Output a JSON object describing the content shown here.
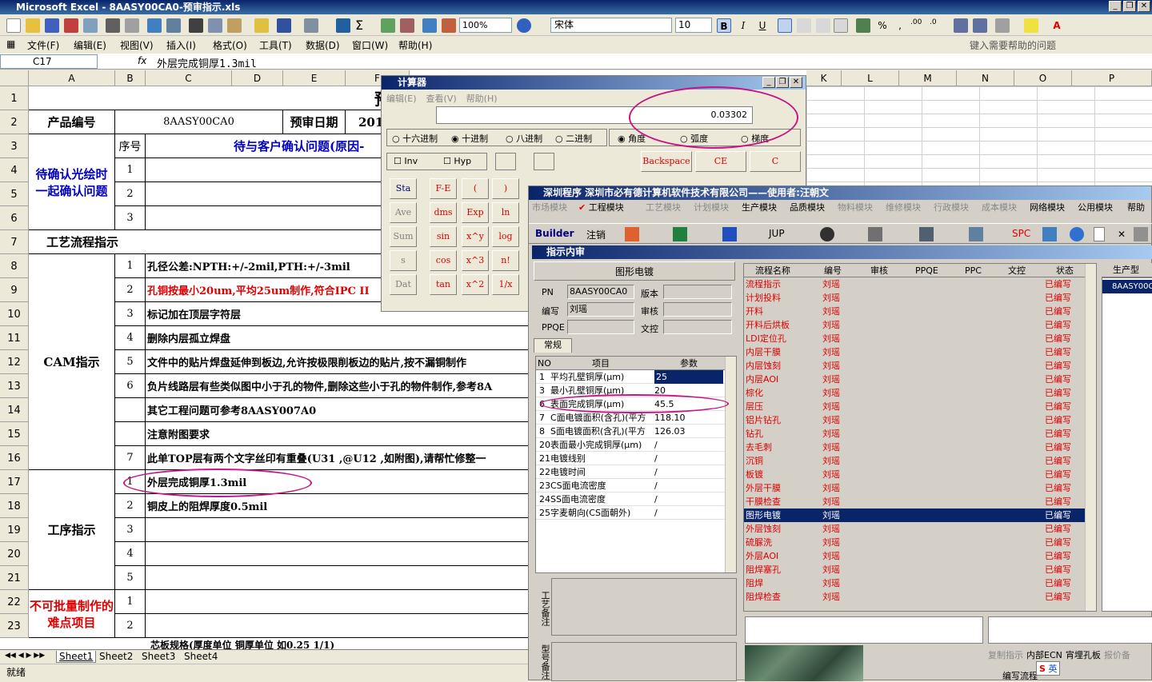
{
  "excel": {
    "title": "Microsoft Excel - 8AASY00CA0-预审指示.xls",
    "zoom": "100%",
    "font_name": "宋体",
    "font_size": "10",
    "menu": [
      "文件(F)",
      "编辑(E)",
      "视图(V)",
      "插入(I)",
      "格式(O)",
      "工具(T)",
      "数据(D)",
      "窗口(W)",
      "帮助(H)"
    ],
    "help_placeholder": "键入需要帮助的问题",
    "name_box": "C17",
    "fx": "fx",
    "formula": "外层完成铜厚1.3mil",
    "columns": [
      "A",
      "B",
      "C",
      "D",
      "E",
      "F",
      "K",
      "L",
      "M",
      "N",
      "O",
      "P"
    ],
    "rows": [
      "1",
      "2",
      "3",
      "4",
      "5",
      "6",
      "7",
      "8",
      "9",
      "10",
      "11",
      "12",
      "13",
      "14",
      "15",
      "16",
      "17",
      "18",
      "19",
      "20",
      "21",
      "22",
      "23"
    ],
    "title_cell": "预",
    "pn_label": "产品编号",
    "pn_value": "8AASY00CA0",
    "date_label": "预审日期",
    "date_value": "201",
    "confirm_label": "待确认光绘时一起确认问题",
    "seq_label": "序号",
    "confirm_title": "待与客户确认问题(原因-",
    "flow_label": "工艺流程指示",
    "cam_label": "CAM指示",
    "process_label": "工序指示",
    "difficult_label": "不可批量制作的难点项目",
    "cam_items": [
      {
        "no": "1",
        "text": "孔径公差:NPTH:+/-2mil,PTH:+/-3mil",
        "color": "#000000"
      },
      {
        "no": "2",
        "text": "孔铜按最小20um,平均25um制作,符合IPC II",
        "color": "#e00000"
      },
      {
        "no": "3",
        "text": "标记加在顶层字符层",
        "color": "#000000"
      },
      {
        "no": "4",
        "text": "删除内层孤立焊盘",
        "color": "#000000"
      },
      {
        "no": "5",
        "text": "文件中的贴片焊盘延伸到板边,允许按极限削板边的贴片,按不漏铜制作",
        "color": "#000000"
      },
      {
        "no": "6",
        "text": "负片线路层有些类似图中小于孔的物件,删除这些小于孔的物件制作,参考8A",
        "color": "#000000"
      },
      {
        "no": "",
        "text": "其它工程问题可参考8AASY007A0",
        "color": "#000000"
      },
      {
        "no": "",
        "text": "注意附图要求",
        "color": "#000000"
      },
      {
        "no": "7",
        "text": "此单TOP层有两个文字丝印有重叠(U31 ,@U12 ,如附图),请帮忙修整一",
        "color": "#000000"
      }
    ],
    "process_items": [
      {
        "no": "1",
        "text": "外层完成铜厚1.3mil"
      },
      {
        "no": "2",
        "text": "铜皮上的阻焊厚度0.5mil"
      },
      {
        "no": "3",
        "text": ""
      },
      {
        "no": "4",
        "text": ""
      },
      {
        "no": "5",
        "text": ""
      }
    ],
    "confirm_nos": [
      "1",
      "2",
      "3"
    ],
    "difficult_nos": [
      "1",
      "2"
    ],
    "row24_text": "芯板规格(厚度单位    铜厚单位    如0.25 1/1)",
    "sheets": [
      "Sheet1",
      "Sheet2",
      "Sheet3",
      "Sheet4"
    ],
    "status": "就绪"
  },
  "calculator": {
    "title": "计算器",
    "menu": [
      "编辑(E)",
      "查看(V)",
      "帮助(H)"
    ],
    "display": "0.03302",
    "bases": [
      "十六进制",
      "十进制",
      "八进制",
      "二进制"
    ],
    "angles": [
      "角度",
      "弧度",
      "梯度"
    ],
    "inv": "Inv",
    "hyp": "Hyp",
    "backspace": "Backspace",
    "ce": "CE",
    "c": "C",
    "left_btns": [
      "Sta",
      "Ave",
      "Sum",
      "s",
      "Dat"
    ],
    "fn_col1": [
      "F-E",
      "dms",
      "sin",
      "cos",
      "tan"
    ],
    "fn_col2": [
      "(",
      "Exp",
      "x^y",
      "x^3",
      "x^2"
    ],
    "fn_col3": [
      ")",
      "ln",
      "log",
      "n!",
      "1/x"
    ]
  },
  "erp": {
    "title": "深圳程序    深圳市必有德计算机软件技术有限公司——使用者:汪朝文",
    "modules": [
      "市场模块",
      "工程模块",
      "工艺模块",
      "计划模块",
      "生产模块",
      "品质模块",
      "物料模块",
      "维修模块",
      "行政模块",
      "成本模块",
      "网络模块",
      "公用模块",
      "帮助"
    ],
    "toolbar": [
      "Builder",
      "注销",
      "JUP",
      "SPC"
    ],
    "subwin_title": "指示内审",
    "section": "图形电镀",
    "pn_label": "PN",
    "pn_value": "8AASY00CA0",
    "version_label": "版本",
    "author_label": "编写",
    "author_value": "刘瑶",
    "review_label": "审核",
    "ppqe_label": "PPQE",
    "doc_label": "文控",
    "tab": "常规",
    "param_headers": [
      "NO",
      "项目",
      "参数"
    ],
    "params": [
      {
        "no": "1",
        "item": "平均孔壁铜厚(μm)",
        "val": "25"
      },
      {
        "no": "3",
        "item": "最小孔壁铜厚(μm)",
        "val": "20"
      },
      {
        "no": "6",
        "item": "表面完成铜厚(μm)",
        "val": "45.5"
      },
      {
        "no": "7",
        "item": "C面电镀面积(含孔)(平方",
        "val": "118.10"
      },
      {
        "no": "8",
        "item": "S面电镀面积(含孔)(平方",
        "val": "126.03"
      },
      {
        "no": "20",
        "item": "表面最小完成铜厚(μm)",
        "val": "/"
      },
      {
        "no": "21",
        "item": "电镀线别",
        "val": "/"
      },
      {
        "no": "22",
        "item": "电镀时间",
        "val": "/"
      },
      {
        "no": "23",
        "item": "CS面电流密度",
        "val": "/"
      },
      {
        "no": "24",
        "item": "SS面电流密度",
        "val": "/"
      },
      {
        "no": "25",
        "item": "字麦朝向(CS面朝外)",
        "val": "/"
      }
    ],
    "note1_label": "工艺备注",
    "note2_label": "型号备注",
    "flow_headers": [
      "流程名称",
      "编号",
      "审核",
      "PPQE",
      "PPC",
      "文控",
      "状态"
    ],
    "flow": [
      {
        "name": "流程指示",
        "by": "刘瑶",
        "st": "已编写"
      },
      {
        "name": "计划投料",
        "by": "刘瑶",
        "st": "已编写"
      },
      {
        "name": "开料",
        "by": "刘瑶",
        "st": "已编写"
      },
      {
        "name": "开料后烘板",
        "by": "刘瑶",
        "st": "已编写"
      },
      {
        "name": "LDI定位孔",
        "by": "刘瑶",
        "st": "已编写"
      },
      {
        "name": "内层干膜",
        "by": "刘瑶",
        "st": "已编写"
      },
      {
        "name": "内层蚀刻",
        "by": "刘瑶",
        "st": "已编写"
      },
      {
        "name": "内层AOI",
        "by": "刘瑶",
        "st": "已编写"
      },
      {
        "name": "棕化",
        "by": "刘瑶",
        "st": "已编写"
      },
      {
        "name": "层压",
        "by": "刘瑶",
        "st": "已编写"
      },
      {
        "name": "铝片钻孔",
        "by": "刘瑶",
        "st": "已编写"
      },
      {
        "name": "钻孔",
        "by": "刘瑶",
        "st": "已编写"
      },
      {
        "name": "去毛刺",
        "by": "刘瑶",
        "st": "已编写"
      },
      {
        "name": "沉铜",
        "by": "刘瑶",
        "st": "已编写"
      },
      {
        "name": "板镀",
        "by": "刘瑶",
        "st": "已编写"
      },
      {
        "name": "外层干膜",
        "by": "刘瑶",
        "st": "已编写"
      },
      {
        "name": "干膜检查",
        "by": "刘瑶",
        "st": "已编写"
      },
      {
        "name": "图形电镀",
        "by": "刘瑶",
        "st": "已编写"
      },
      {
        "name": "外层蚀刻",
        "by": "刘瑶",
        "st": "已编写"
      },
      {
        "name": "硫脲洗",
        "by": "刘瑶",
        "st": "已编写"
      },
      {
        "name": "外层AOI",
        "by": "刘瑶",
        "st": "已编写"
      },
      {
        "name": "阻焊塞孔",
        "by": "刘瑶",
        "st": "已编写"
      },
      {
        "name": "阻焊",
        "by": "刘瑶",
        "st": "已编写"
      },
      {
        "name": "阻焊检查",
        "by": "刘瑶",
        "st": "已编写"
      }
    ],
    "right_hdr": "生产型",
    "right_val": "8AASY00C",
    "bottom_btns": [
      "复制指示",
      "内部ECN",
      "宵埋孔板",
      "报价备"
    ],
    "bottom_btn2": "编写流程",
    "ime": "英"
  }
}
